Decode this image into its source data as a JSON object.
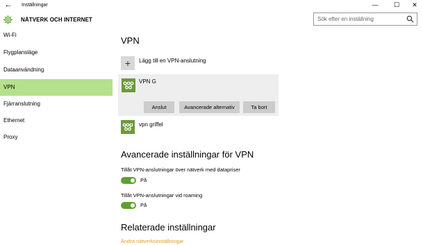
{
  "edge_marker": "8",
  "window": {
    "title": "Inställningar",
    "minimize_glyph": "—",
    "maximize_glyph": "☐",
    "close_glyph": "✕"
  },
  "header": {
    "section_title": "NÄTVERK OCH INTERNET",
    "icon": "gear-icon",
    "search": {
      "placeholder": "Sök efter en inställning",
      "icon": "search-icon"
    }
  },
  "sidebar": {
    "items": [
      {
        "label": "Wi-Fi",
        "selected": false
      },
      {
        "label": "Flygplansläge",
        "selected": false
      },
      {
        "label": "Dataanvändning",
        "selected": false
      },
      {
        "label": "VPN",
        "selected": true
      },
      {
        "label": "Fjärranslutning",
        "selected": false
      },
      {
        "label": "Ethernet",
        "selected": false
      },
      {
        "label": "Proxy",
        "selected": false
      }
    ]
  },
  "main": {
    "heading": "VPN",
    "add_vpn_label": "Lägg till en VPN-anslutning",
    "add_vpn_glyph": "+",
    "connections": [
      {
        "name": "VPN G",
        "expanded": true,
        "buttons": {
          "connect": "Anslut",
          "advanced": "Avancerade alternativ",
          "remove": "Ta bort"
        }
      },
      {
        "name": "vpn griffel",
        "expanded": false
      }
    ],
    "advanced": {
      "heading": "Avancerade inställningar för VPN",
      "metered": {
        "label": "Tillåt VPN-anslutningar över nätverk med datapriser",
        "state": "På",
        "on": true
      },
      "roaming": {
        "label": "Tillåt VPN-anslutningar vid roaming",
        "state": "På",
        "on": true
      }
    },
    "related": {
      "heading": "Relaterade inställningar",
      "link": "Ändra nätverksinställningar"
    }
  },
  "colors": {
    "accent": "#5ea12d",
    "selected_nav": "#b5e08c",
    "vpn_tile": "#6b9a3c",
    "card_bg": "#eeeeee",
    "button_bg": "#cccccc",
    "link": "#e0a020"
  }
}
